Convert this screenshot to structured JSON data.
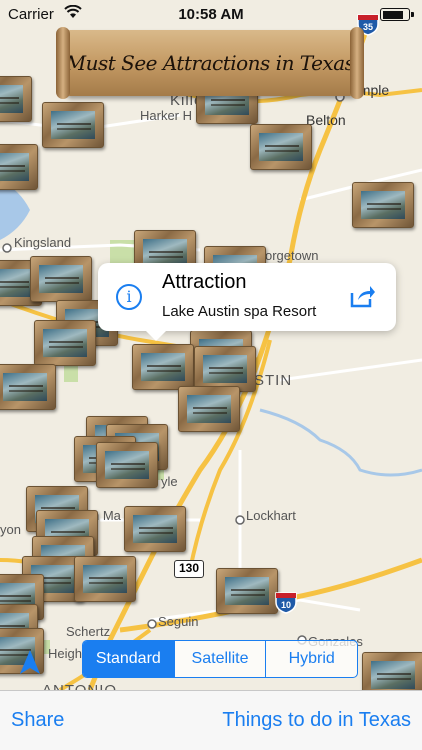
{
  "status_bar": {
    "carrier": "Carrier",
    "time": "10:58 AM",
    "wifi_icon": "wifi-icon",
    "battery_level": 0.85
  },
  "banner": {
    "title": "Must See Attractions in Texas"
  },
  "map": {
    "labels": {
      "temple": "Temple",
      "belton": "Belton",
      "harker_heights": "Harker H",
      "killeen": "Kille",
      "kingsland": "Kingsland",
      "georgetown": "orgetown",
      "austin": "STIN",
      "lockhart": "Lockhart",
      "gonzales": "Gonzales",
      "seguin": "Seguin",
      "schertz": "Schertz",
      "san_marcos": "n Ma",
      "kyle": "yle",
      "canyon": "yon",
      "heights": "Heigh",
      "antonio": "ANTONIO"
    },
    "shields": {
      "i35": "35",
      "i10": "10",
      "sh130": "130"
    },
    "colors": {
      "land": "#f1ede2",
      "highway": "#f6c243",
      "road": "#ffffff",
      "water": "#a8c8e8",
      "park": "#c9dfa8",
      "accent": "#1a7ef0"
    }
  },
  "callout": {
    "title": "Attraction",
    "subtitle": "Lake Austin spa Resort",
    "info_icon": "info-icon",
    "share_icon": "share-icon"
  },
  "map_type": {
    "options": [
      "Standard",
      "Satellite",
      "Hybrid"
    ],
    "selected": "Standard"
  },
  "toolbar": {
    "share_label": "Share",
    "things_label": "Things to do in Texas"
  }
}
